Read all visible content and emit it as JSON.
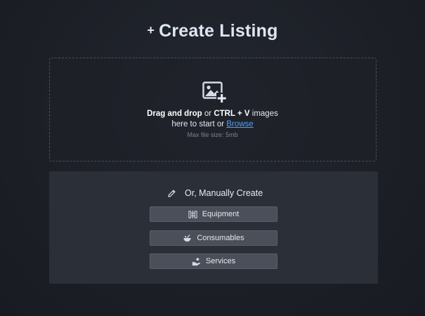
{
  "title": {
    "plus": "+",
    "text": "Create Listing"
  },
  "dropzone": {
    "strong1": "Drag and drop",
    "mid": " or ",
    "strong2": "CTRL + V",
    "tail": " images",
    "line2_prefix": "here to start or ",
    "browse_label": "Browse",
    "hint": "Max file size: 5mb",
    "icon": "image-add-icon"
  },
  "manual": {
    "header": "Or, Manually Create",
    "header_icon": "pencil-icon",
    "buttons": [
      {
        "label": "Equipment",
        "icon": "equipment-icon"
      },
      {
        "label": "Consumables",
        "icon": "consumables-icon"
      },
      {
        "label": "Services",
        "icon": "services-icon"
      }
    ]
  },
  "colors": {
    "background": "#1c1f26",
    "panel": "#2b2f37",
    "button": "#4a4f59",
    "link": "#4aa3ff"
  }
}
